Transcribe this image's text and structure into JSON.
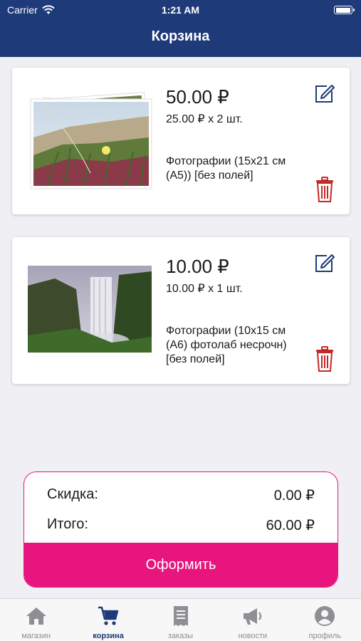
{
  "status_bar": {
    "carrier": "Carrier",
    "time": "1:21 AM",
    "battery_level": 1.0
  },
  "header": {
    "title": "Корзина"
  },
  "cart": {
    "items": [
      {
        "price": "50.00 ₽",
        "unit_qty": "25.00 ₽ x 2 шт.",
        "description": "Фотографии (15x21 см (А5)) [без полей]",
        "thumbnail": "photo-stack-plants"
      },
      {
        "price": "10.00 ₽",
        "unit_qty": "10.00 ₽ x 1 шт.",
        "description": "Фотографии (10x15 см (А6) фотолаб несрочн) [без полей]",
        "thumbnail": "photo-waterfall"
      }
    ]
  },
  "summary": {
    "discount_label": "Скидка:",
    "discount_value": "0.00 ₽",
    "total_label": "Итого:",
    "total_value": "60.00 ₽",
    "checkout_label": "Оформить"
  },
  "tabbar": {
    "tabs": [
      {
        "label": "магазин",
        "icon": "home-icon",
        "active": false
      },
      {
        "label": "корзина",
        "icon": "cart-icon",
        "active": true
      },
      {
        "label": "заказы",
        "icon": "receipt-icon",
        "active": false
      },
      {
        "label": "новости",
        "icon": "megaphone-icon",
        "active": false
      },
      {
        "label": "профиль",
        "icon": "profile-icon",
        "active": false
      }
    ]
  },
  "colors": {
    "header": "#1e3a78",
    "accent": "#e8157f",
    "delete": "#c62828",
    "tab_inactive": "#8e8e93"
  }
}
